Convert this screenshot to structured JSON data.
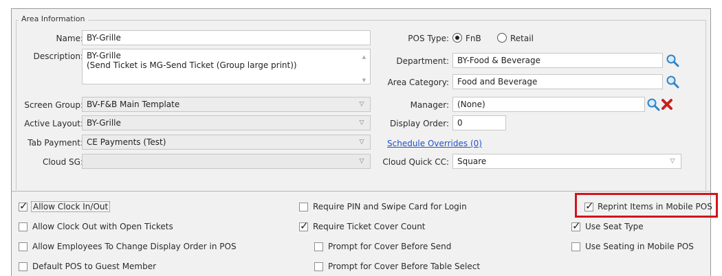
{
  "group_title": "Area Information",
  "name": {
    "label": "Name:",
    "value": "BY-Grille"
  },
  "description": {
    "label": "Description:",
    "line1": "BY-Grille",
    "line2": "(Send Ticket is MG-Send Ticket (Group large print))"
  },
  "screen_group": {
    "label": "Screen Group:",
    "value": "BV-F&B Main Template"
  },
  "active_layout": {
    "label": "Active Layout:",
    "value": "BY-Grille"
  },
  "tab_payment": {
    "label": "Tab Payment:",
    "value": "CE Payments (Test)"
  },
  "cloud_sg": {
    "label": "Cloud SG:",
    "value": ""
  },
  "pos_type": {
    "label": "POS Type:",
    "options": [
      "FnB",
      "Retail"
    ],
    "selected": "FnB"
  },
  "department": {
    "label": "Department:",
    "value": "BY-Food & Beverage"
  },
  "area_category": {
    "label": "Area Category:",
    "value": "Food and Beverage"
  },
  "manager": {
    "label": "Manager:",
    "value": "(None)"
  },
  "display_order": {
    "label": "Display Order:",
    "value": "0"
  },
  "schedule_overrides": {
    "text": "Schedule Overrides (0)"
  },
  "cloud_quick_cc": {
    "label": "Cloud Quick CC:",
    "value": "Square"
  },
  "checkboxes": {
    "allow_clock": {
      "label": "Allow Clock In/Out",
      "checked": true
    },
    "allow_clock_out": {
      "label": "Allow Clock Out with Open Tickets",
      "checked": false
    },
    "allow_employees": {
      "label": "Allow Employees To Change Display Order in POS",
      "checked": false
    },
    "default_pos": {
      "label": "Default POS to Guest Member",
      "checked": false
    },
    "require_pin": {
      "label": "Require PIN and Swipe Card for Login",
      "checked": false
    },
    "require_cover": {
      "label": "Require Ticket Cover Count",
      "checked": true
    },
    "prompt_send": {
      "label": "Prompt for Cover Before Send",
      "checked": false
    },
    "prompt_table": {
      "label": "Prompt for Cover Before Table Select",
      "checked": false
    },
    "reprint_items": {
      "label": "Reprint Items in Mobile POS",
      "checked": true
    },
    "use_seat": {
      "label": "Use Seat Type",
      "checked": true
    },
    "use_seating": {
      "label": "Use Seating in Mobile POS",
      "checked": false
    }
  },
  "colors": {
    "highlight": "#d0141e",
    "link": "#2350c8",
    "search_icon": "#2f84c8",
    "clear_icon": "#c8201e"
  }
}
